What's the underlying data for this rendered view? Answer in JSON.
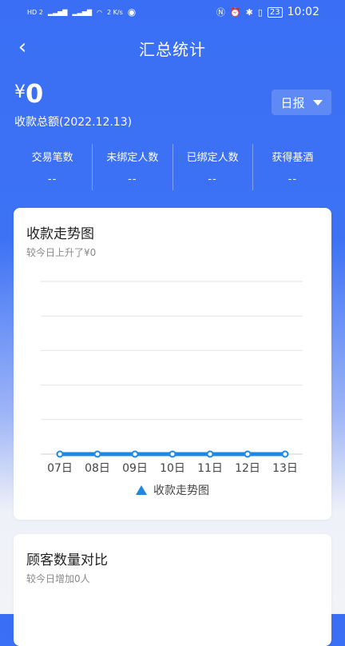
{
  "status_bar": {
    "left_icons": [
      "hd-icon",
      "signal-icon",
      "signal-icon",
      "wifi-icon",
      "eye-icon"
    ],
    "net_speed": "2 K/s",
    "time": "10:02",
    "battery": "23"
  },
  "nav": {
    "title": "汇总统计"
  },
  "summary": {
    "currency": "¥",
    "amount": "0",
    "label": "收款总额(2022.12.13)",
    "period": "日报"
  },
  "stats": [
    {
      "label": "交易笔数",
      "value": "--"
    },
    {
      "label": "未绑定人数",
      "value": "--"
    },
    {
      "label": "已绑定人数",
      "value": "--"
    },
    {
      "label": "获得基酒",
      "value": "--"
    }
  ],
  "trend_card": {
    "title": "收款走势图",
    "subtitle": "较今日上升了¥0",
    "legend": "收款走势图"
  },
  "customers_card": {
    "title": "顾客数量对比",
    "subtitle": "较今日增加0人"
  },
  "colors": {
    "accent": "#3a6ff5",
    "line": "#1d87e4"
  },
  "chart_data": {
    "type": "line",
    "categories": [
      "07日",
      "08日",
      "09日",
      "10日",
      "11日",
      "12日",
      "13日"
    ],
    "series": [
      {
        "name": "收款走势图",
        "values": [
          0,
          0,
          0,
          0,
          0,
          0,
          0
        ]
      }
    ],
    "gridlines": 5,
    "ylim": [
      0,
      5
    ],
    "legend_position": "bottom",
    "grid": true
  }
}
